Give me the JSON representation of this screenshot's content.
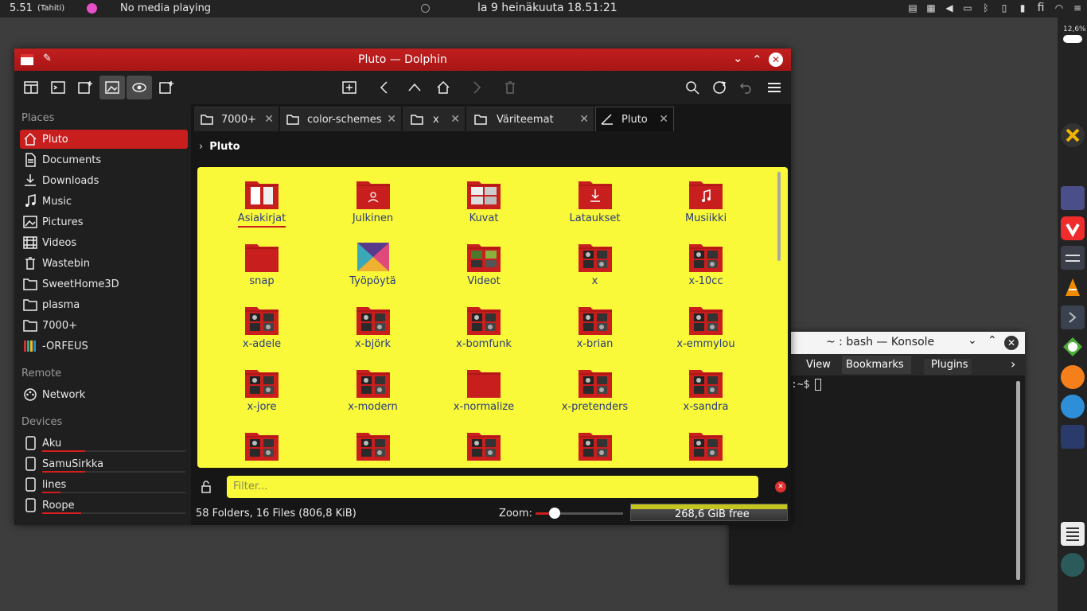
{
  "topbar": {
    "time_left": "5.51",
    "tz": "(Tahiti)",
    "media": "No media playing",
    "clock": "la 9 heinäkuuta 18.51:21",
    "lang": "fi"
  },
  "dock": {
    "battery": "12,6%"
  },
  "dolphin": {
    "title": "Pluto — Dolphin",
    "places_header": "Places",
    "places": [
      {
        "label": "Pluto",
        "icon": "home-icon"
      },
      {
        "label": "Documents",
        "icon": "documents-icon"
      },
      {
        "label": "Downloads",
        "icon": "download-icon"
      },
      {
        "label": "Music",
        "icon": "music-icon"
      },
      {
        "label": "Pictures",
        "icon": "picture-icon"
      },
      {
        "label": "Videos",
        "icon": "video-icon"
      },
      {
        "label": "Wastebin",
        "icon": "trash-icon"
      },
      {
        "label": "SweetHome3D",
        "icon": "folder-icon"
      },
      {
        "label": "plasma",
        "icon": "folder-icon"
      },
      {
        "label": "7000+",
        "icon": "folder-icon"
      },
      {
        "label": "-ORFEUS",
        "icon": "library-icon"
      }
    ],
    "remote_header": "Remote",
    "remote": [
      {
        "label": "Network",
        "icon": "network-icon"
      }
    ],
    "devices_header": "Devices",
    "devices": [
      {
        "label": "Aku",
        "usage": 0.3
      },
      {
        "label": "SamuSirkka",
        "usage": 0.3
      },
      {
        "label": "lines",
        "usage": 0.13
      },
      {
        "label": "Roope",
        "usage": 0.27
      }
    ],
    "tabs": [
      {
        "label": "7000+"
      },
      {
        "label": "color-schemes"
      },
      {
        "label": "x"
      },
      {
        "label": "Väriteemat"
      },
      {
        "label": "Pluto"
      }
    ],
    "breadcrumb": "Pluto",
    "files": [
      {
        "label": "Asiakirjat"
      },
      {
        "label": "Julkinen"
      },
      {
        "label": "Kuvat"
      },
      {
        "label": "Lataukset"
      },
      {
        "label": "Musiikki"
      },
      {
        "label": "snap"
      },
      {
        "label": "Työpöytä"
      },
      {
        "label": "Videot"
      },
      {
        "label": "x"
      },
      {
        "label": "x-10cc"
      },
      {
        "label": "x-adele"
      },
      {
        "label": "x-björk"
      },
      {
        "label": "x-bomfunk"
      },
      {
        "label": "x-brian"
      },
      {
        "label": "x-emmylou"
      },
      {
        "label": "x-jore"
      },
      {
        "label": "x-modern"
      },
      {
        "label": "x-normalize"
      },
      {
        "label": "x-pretenders"
      },
      {
        "label": "x-sandra"
      },
      {
        "label": ""
      },
      {
        "label": ""
      },
      {
        "label": ""
      },
      {
        "label": ""
      },
      {
        "label": ""
      }
    ],
    "filter_placeholder": "Filter...",
    "status": "58 Folders, 16 Files (806,8 KiB)",
    "zoom_label": "Zoom:",
    "zoom_level": 0.22,
    "free_space": "268,6 GiB free",
    "colors": {
      "accent": "#c81e1e",
      "view_bg": "#f9f93a",
      "label": "#2a3b7a"
    }
  },
  "konsole": {
    "title": "~ : bash — Konsole",
    "menu": [
      "View",
      "Bookmarks",
      "Plugins"
    ],
    "prompt": ":~$"
  }
}
